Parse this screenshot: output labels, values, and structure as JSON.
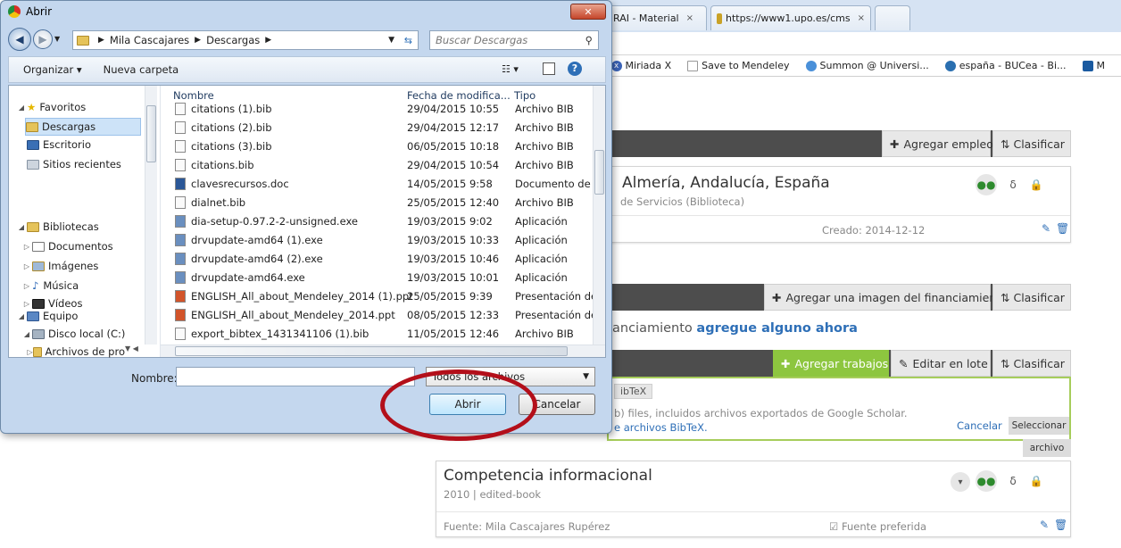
{
  "browser": {
    "tabs": [
      {
        "label": "RAI - Material",
        "close": "×"
      },
      {
        "label": "https://www1.upo.es/cms",
        "close": "×"
      }
    ],
    "bookmarks": [
      "Miriada X",
      "Save to Mendeley",
      "Summon @ Universi...",
      "españa - BUCea - Bi...",
      "M"
    ]
  },
  "page": {
    "employment_bar": {
      "add": "Agregar empleo",
      "sort": "Clasificar"
    },
    "employment_card": {
      "title": "Almería, Andalucía, España",
      "subtitle": "de Servicios (Biblioteca)",
      "created": "Creado: 2014-12-12"
    },
    "funding_bar": {
      "add": "Agregar una imagen del financiamiento",
      "sort": "Clasificar"
    },
    "funding_text": "anciamiento",
    "funding_link": "agregue alguno ahora",
    "works_bar": {
      "add": "Agregar trabajos",
      "batch": "Editar en lote",
      "sort": "Clasificar"
    },
    "bibtex_panel": {
      "tag": "ibTeX",
      "line1": "b) files, incluidos archivos exportados de Google Scholar.",
      "line2": "e archivos BibTeX.",
      "cancel": "Cancelar",
      "select": "Seleccionar",
      "select2": "archivo"
    },
    "work_card": {
      "title": "Competencia informacional",
      "meta": "2010 | edited-book",
      "source": "Fuente: Mila Cascajares Rupérez",
      "preferred": "Fuente preferida"
    }
  },
  "dialog": {
    "title": "Abrir",
    "close": "✕",
    "path": [
      "Mila Cascajares",
      "Descargas"
    ],
    "search_placeholder": "Buscar Descargas",
    "organize": "Organizar ▾",
    "new_folder": "Nueva carpeta",
    "nav": {
      "favorites": "Favoritos",
      "downloads": "Descargas",
      "desktop": "Escritorio",
      "recent": "Sitios recientes",
      "libraries": "Bibliotecas",
      "documents": "Documentos",
      "images": "Imágenes",
      "music": "Música",
      "videos": "Vídeos",
      "computer": "Equipo",
      "local_disk": "Disco local (C:)",
      "program_files": "Archivos de pro"
    },
    "columns": {
      "name": "Nombre",
      "date": "Fecha de modifica...",
      "type": "Tipo"
    },
    "files": [
      {
        "name": "citations (1).bib",
        "date": "29/04/2015 10:55",
        "type": "Archivo BIB"
      },
      {
        "name": "citations (2).bib",
        "date": "29/04/2015 12:17",
        "type": "Archivo BIB"
      },
      {
        "name": "citations (3).bib",
        "date": "06/05/2015 10:18",
        "type": "Archivo BIB"
      },
      {
        "name": "citations.bib",
        "date": "29/04/2015 10:54",
        "type": "Archivo BIB"
      },
      {
        "name": "clavesrecursos.doc",
        "date": "14/05/2015 9:58",
        "type": "Documento de M"
      },
      {
        "name": "dialnet.bib",
        "date": "25/05/2015 12:40",
        "type": "Archivo BIB"
      },
      {
        "name": "dia-setup-0.97.2-2-unsigned.exe",
        "date": "19/03/2015 9:02",
        "type": "Aplicación"
      },
      {
        "name": "drvupdate-amd64 (1).exe",
        "date": "19/03/2015 10:33",
        "type": "Aplicación"
      },
      {
        "name": "drvupdate-amd64 (2).exe",
        "date": "19/03/2015 10:46",
        "type": "Aplicación"
      },
      {
        "name": "drvupdate-amd64.exe",
        "date": "19/03/2015 10:01",
        "type": "Aplicación"
      },
      {
        "name": "ENGLISH_All_about_Mendeley_2014 (1).ppt",
        "date": "25/05/2015 9:39",
        "type": "Presentación de ..."
      },
      {
        "name": "ENGLISH_All_about_Mendeley_2014.ppt",
        "date": "08/05/2015 12:33",
        "type": "Presentación de ..."
      },
      {
        "name": "export_bibtex_1431341106 (1).bib",
        "date": "11/05/2015 12:46",
        "type": "Archivo BIB"
      }
    ],
    "name_label": "Nombre:",
    "name_value": "",
    "filter": "Todos los archivos",
    "open": "Abrir",
    "cancel": "Cancelar"
  }
}
